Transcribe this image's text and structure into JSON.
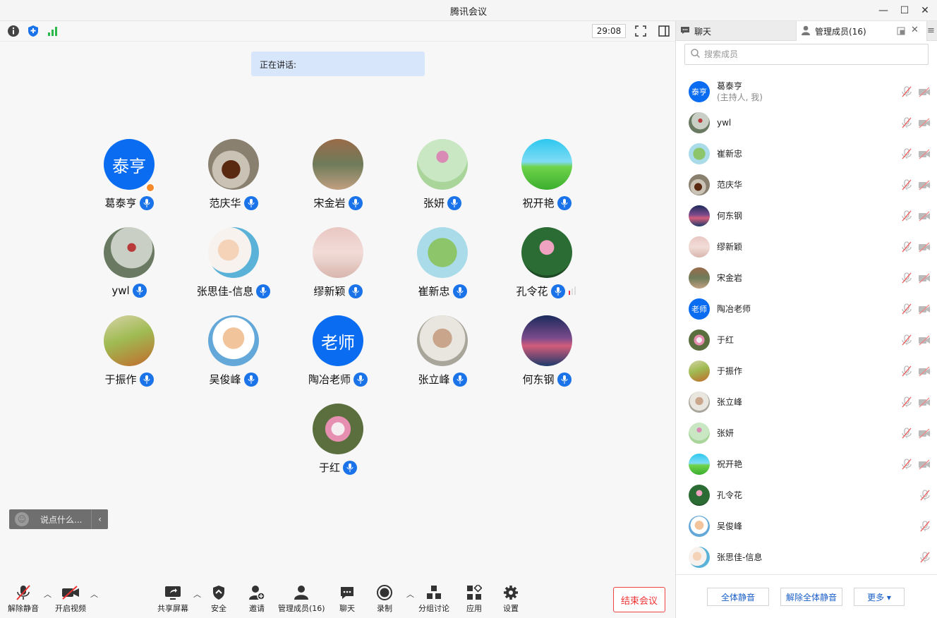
{
  "window": {
    "title": "腾讯会议"
  },
  "topbar": {
    "timer": "29:08"
  },
  "speaking": {
    "label": "正在讲话:"
  },
  "tiles": [
    {
      "name": "葛泰亨",
      "avatar_text": "泰亨",
      "host": true
    },
    {
      "name": "范庆华"
    },
    {
      "name": "宋金岩"
    },
    {
      "name": "张妍"
    },
    {
      "name": "祝开艳"
    },
    {
      "name": "ywl"
    },
    {
      "name": "张思佳-信息"
    },
    {
      "name": "缪新颖"
    },
    {
      "name": "崔新忠"
    },
    {
      "name": "孔令花"
    },
    {
      "name": "于振作"
    },
    {
      "name": "吴俊峰"
    },
    {
      "name": "陶冶老师",
      "avatar_text": "老师"
    },
    {
      "name": "张立峰"
    },
    {
      "name": "何东钢"
    },
    {
      "name": "于红"
    }
  ],
  "chat": {
    "placeholder": "说点什么..."
  },
  "toolbar": {
    "unmute": "解除静音",
    "start_video": "开启视频",
    "share": "共享屏幕",
    "security": "安全",
    "invite": "邀请",
    "manage": "管理成员(16)",
    "chat": "聊天",
    "record": "录制",
    "breakout": "分组讨论",
    "apps": "应用",
    "settings": "设置",
    "end": "结束会议"
  },
  "panel": {
    "tab_chat": "聊天",
    "tab_members": "管理成员(16)",
    "search_placeholder": "搜索成员",
    "members": [
      {
        "name": "葛泰亨",
        "sub": "(主持人, 我)",
        "avatar_text": "泰亨"
      },
      {
        "name": "ywl"
      },
      {
        "name": "崔新忠"
      },
      {
        "name": "范庆华"
      },
      {
        "name": "何东钢"
      },
      {
        "name": "缪新颖"
      },
      {
        "name": "宋金岩"
      },
      {
        "name": "陶冶老师",
        "avatar_text": "老师"
      },
      {
        "name": "于红"
      },
      {
        "name": "于振作"
      },
      {
        "name": "张立峰"
      },
      {
        "name": "张妍"
      },
      {
        "name": "祝开艳"
      },
      {
        "name": "孔令花"
      },
      {
        "name": "吴俊峰"
      },
      {
        "name": "张思佳-信息"
      }
    ],
    "mute_all": "全体静音",
    "unmute_all": "解除全体静音",
    "more": "更多 ▾"
  },
  "colors": {
    "accent": "#0a6cf0",
    "mic_blue": "#1a73e8",
    "end_red": "#e33333"
  }
}
